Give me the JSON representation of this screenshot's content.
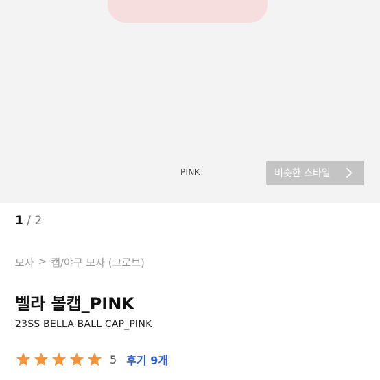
{
  "hero": {
    "color_caption": "PINK",
    "similar_style_button": "비슷한 스타일",
    "chevron_icon": "chevron-right-icon"
  },
  "pager": {
    "current": "1",
    "separator": "/",
    "total": "2"
  },
  "breadcrumb": [
    "모자",
    ">",
    "캡/야구 모자 (그로브)"
  ],
  "product": {
    "title": "벨라 볼캡_PINK",
    "subtitle": "23SS BELLA BALL CAP_PINK"
  },
  "rating": {
    "stars": 5,
    "value": "5",
    "review_link": "후기 9개",
    "star_color": "#f5943a",
    "link_color": "#2b5fd9"
  }
}
